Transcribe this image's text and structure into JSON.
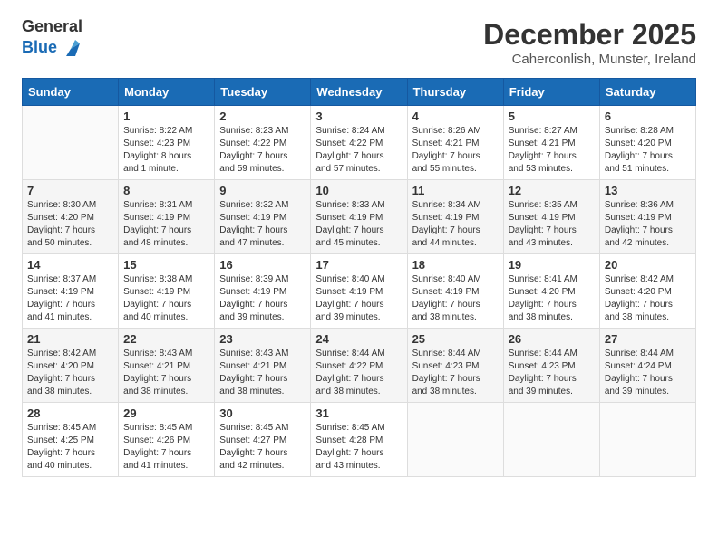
{
  "logo": {
    "text_general": "General",
    "text_blue": "Blue"
  },
  "title": "December 2025",
  "subtitle": "Caherconlish, Munster, Ireland",
  "headers": [
    "Sunday",
    "Monday",
    "Tuesday",
    "Wednesday",
    "Thursday",
    "Friday",
    "Saturday"
  ],
  "weeks": [
    [
      {
        "day": "",
        "info": ""
      },
      {
        "day": "1",
        "info": "Sunrise: 8:22 AM\nSunset: 4:23 PM\nDaylight: 8 hours\nand 1 minute."
      },
      {
        "day": "2",
        "info": "Sunrise: 8:23 AM\nSunset: 4:22 PM\nDaylight: 7 hours\nand 59 minutes."
      },
      {
        "day": "3",
        "info": "Sunrise: 8:24 AM\nSunset: 4:22 PM\nDaylight: 7 hours\nand 57 minutes."
      },
      {
        "day": "4",
        "info": "Sunrise: 8:26 AM\nSunset: 4:21 PM\nDaylight: 7 hours\nand 55 minutes."
      },
      {
        "day": "5",
        "info": "Sunrise: 8:27 AM\nSunset: 4:21 PM\nDaylight: 7 hours\nand 53 minutes."
      },
      {
        "day": "6",
        "info": "Sunrise: 8:28 AM\nSunset: 4:20 PM\nDaylight: 7 hours\nand 51 minutes."
      }
    ],
    [
      {
        "day": "7",
        "info": "Sunrise: 8:30 AM\nSunset: 4:20 PM\nDaylight: 7 hours\nand 50 minutes."
      },
      {
        "day": "8",
        "info": "Sunrise: 8:31 AM\nSunset: 4:19 PM\nDaylight: 7 hours\nand 48 minutes."
      },
      {
        "day": "9",
        "info": "Sunrise: 8:32 AM\nSunset: 4:19 PM\nDaylight: 7 hours\nand 47 minutes."
      },
      {
        "day": "10",
        "info": "Sunrise: 8:33 AM\nSunset: 4:19 PM\nDaylight: 7 hours\nand 45 minutes."
      },
      {
        "day": "11",
        "info": "Sunrise: 8:34 AM\nSunset: 4:19 PM\nDaylight: 7 hours\nand 44 minutes."
      },
      {
        "day": "12",
        "info": "Sunrise: 8:35 AM\nSunset: 4:19 PM\nDaylight: 7 hours\nand 43 minutes."
      },
      {
        "day": "13",
        "info": "Sunrise: 8:36 AM\nSunset: 4:19 PM\nDaylight: 7 hours\nand 42 minutes."
      }
    ],
    [
      {
        "day": "14",
        "info": "Sunrise: 8:37 AM\nSunset: 4:19 PM\nDaylight: 7 hours\nand 41 minutes."
      },
      {
        "day": "15",
        "info": "Sunrise: 8:38 AM\nSunset: 4:19 PM\nDaylight: 7 hours\nand 40 minutes."
      },
      {
        "day": "16",
        "info": "Sunrise: 8:39 AM\nSunset: 4:19 PM\nDaylight: 7 hours\nand 39 minutes."
      },
      {
        "day": "17",
        "info": "Sunrise: 8:40 AM\nSunset: 4:19 PM\nDaylight: 7 hours\nand 39 minutes."
      },
      {
        "day": "18",
        "info": "Sunrise: 8:40 AM\nSunset: 4:19 PM\nDaylight: 7 hours\nand 38 minutes."
      },
      {
        "day": "19",
        "info": "Sunrise: 8:41 AM\nSunset: 4:20 PM\nDaylight: 7 hours\nand 38 minutes."
      },
      {
        "day": "20",
        "info": "Sunrise: 8:42 AM\nSunset: 4:20 PM\nDaylight: 7 hours\nand 38 minutes."
      }
    ],
    [
      {
        "day": "21",
        "info": "Sunrise: 8:42 AM\nSunset: 4:20 PM\nDaylight: 7 hours\nand 38 minutes."
      },
      {
        "day": "22",
        "info": "Sunrise: 8:43 AM\nSunset: 4:21 PM\nDaylight: 7 hours\nand 38 minutes."
      },
      {
        "day": "23",
        "info": "Sunrise: 8:43 AM\nSunset: 4:21 PM\nDaylight: 7 hours\nand 38 minutes."
      },
      {
        "day": "24",
        "info": "Sunrise: 8:44 AM\nSunset: 4:22 PM\nDaylight: 7 hours\nand 38 minutes."
      },
      {
        "day": "25",
        "info": "Sunrise: 8:44 AM\nSunset: 4:23 PM\nDaylight: 7 hours\nand 38 minutes."
      },
      {
        "day": "26",
        "info": "Sunrise: 8:44 AM\nSunset: 4:23 PM\nDaylight: 7 hours\nand 39 minutes."
      },
      {
        "day": "27",
        "info": "Sunrise: 8:44 AM\nSunset: 4:24 PM\nDaylight: 7 hours\nand 39 minutes."
      }
    ],
    [
      {
        "day": "28",
        "info": "Sunrise: 8:45 AM\nSunset: 4:25 PM\nDaylight: 7 hours\nand 40 minutes."
      },
      {
        "day": "29",
        "info": "Sunrise: 8:45 AM\nSunset: 4:26 PM\nDaylight: 7 hours\nand 41 minutes."
      },
      {
        "day": "30",
        "info": "Sunrise: 8:45 AM\nSunset: 4:27 PM\nDaylight: 7 hours\nand 42 minutes."
      },
      {
        "day": "31",
        "info": "Sunrise: 8:45 AM\nSunset: 4:28 PM\nDaylight: 7 hours\nand 43 minutes."
      },
      {
        "day": "",
        "info": ""
      },
      {
        "day": "",
        "info": ""
      },
      {
        "day": "",
        "info": ""
      }
    ]
  ]
}
